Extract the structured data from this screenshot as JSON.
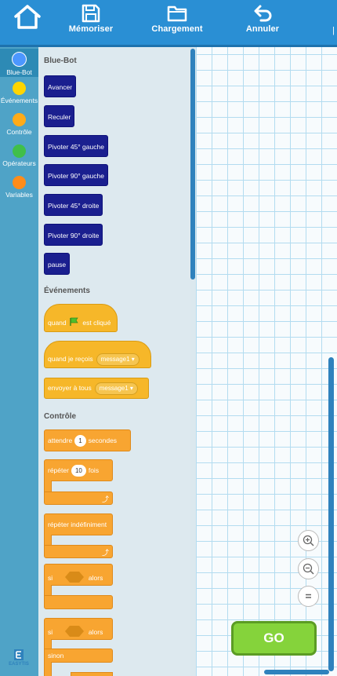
{
  "toolbar": {
    "save_label": "Mémoriser",
    "load_label": "Chargement",
    "undo_label": "Annuler",
    "divider": "|"
  },
  "sidebar": {
    "items": [
      {
        "label": "Blue-Bot",
        "color": "#4c97ff"
      },
      {
        "label": "Événements",
        "color": "#ffd500"
      },
      {
        "label": "Contrôle",
        "color": "#ffab19"
      },
      {
        "label": "Opérateurs",
        "color": "#40bf4a"
      },
      {
        "label": "Variables",
        "color": "#ff8c1a"
      }
    ]
  },
  "palette": {
    "bluebot": {
      "title": "Blue-Bot",
      "blocks": [
        "Avancer",
        "Reculer",
        "Pivoter 45° gauche",
        "Pivoter 90° gauche",
        "Pivoter 45° droite",
        "Pivoter 90° droite",
        "pause"
      ]
    },
    "events": {
      "title": "Événements",
      "when_flag": {
        "before": "quand",
        "after": "est cliqué"
      },
      "when_receive": {
        "label": "quand je reçois",
        "value": "message1"
      },
      "broadcast": {
        "label": "envoyer à tous",
        "value": "message1"
      }
    },
    "control": {
      "title": "Contrôle",
      "wait": {
        "before": "attendre",
        "value": "1",
        "after": "secondes"
      },
      "repeat": {
        "before": "répéter",
        "value": "10",
        "after": "fois"
      },
      "forever": {
        "label": "répéter indéfiniment"
      },
      "if": {
        "before": "si",
        "after": "alors"
      },
      "ifelse": {
        "before": "si",
        "after": "alors",
        "else": "sinon"
      }
    }
  },
  "go_label": "GO",
  "logo_text": "EASYTIS",
  "colors": {
    "topbar": "#2a8fd4",
    "sidebar": "#4fa3c7",
    "motion_block": "#1a1f8f",
    "event_block": "#f6b729",
    "control_block": "#f8a531",
    "go_button": "#85d33b"
  }
}
